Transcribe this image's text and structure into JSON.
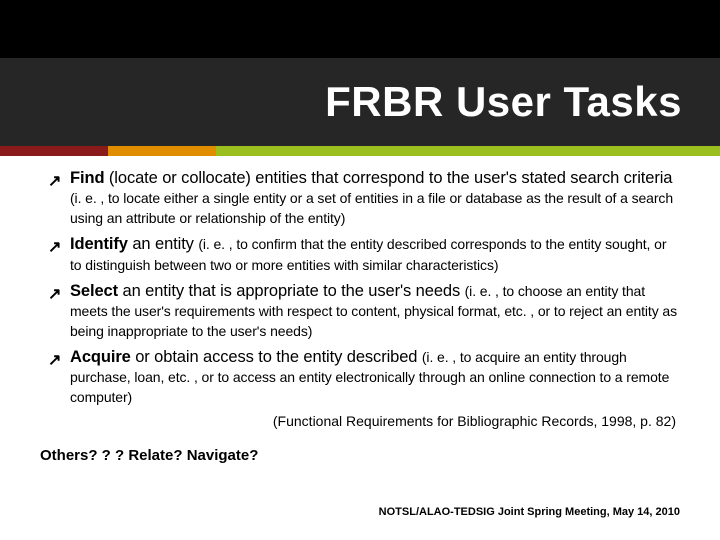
{
  "title": "FRBR User Tasks",
  "accent_colors": {
    "red": "#8B1A1A",
    "orange": "#E08E00",
    "green": "#9BBF1F"
  },
  "bullets": [
    {
      "lead": "Find",
      "mid": " (locate or collocate) entities that correspond to the user's stated search criteria ",
      "paren": "(i. e. , to locate either a single entity or a set of entities in a file or database as the result of a search using an attribute or relationship of the entity)"
    },
    {
      "lead": "Identify",
      "mid": " an entity ",
      "paren": "(i. e. , to confirm that the entity described corresponds to the entity sought, or to distinguish between two or more entities with similar characteristics)"
    },
    {
      "lead": "Select",
      "mid": " an entity that is appropriate to the user's needs ",
      "paren": "(i. e. , to choose an entity that meets the user's requirements with respect to content, physical format, etc. , or to reject an entity as being inappropriate to the user's needs)"
    },
    {
      "lead": "Acquire",
      "mid": " or obtain access to the entity described ",
      "paren": "(i. e. , to acquire an entity through purchase, loan, etc. , or to access an entity electronically through an online connection to a remote computer)"
    }
  ],
  "citation": "(Functional Requirements for Bibliographic Records, 1998, p. 82)",
  "others": "Others? ? ? Relate? Navigate?",
  "footer": "NOTSL/ALAO-TEDSIG Joint Spring Meeting, May 14, 2010",
  "arrow_glyph": "↗"
}
